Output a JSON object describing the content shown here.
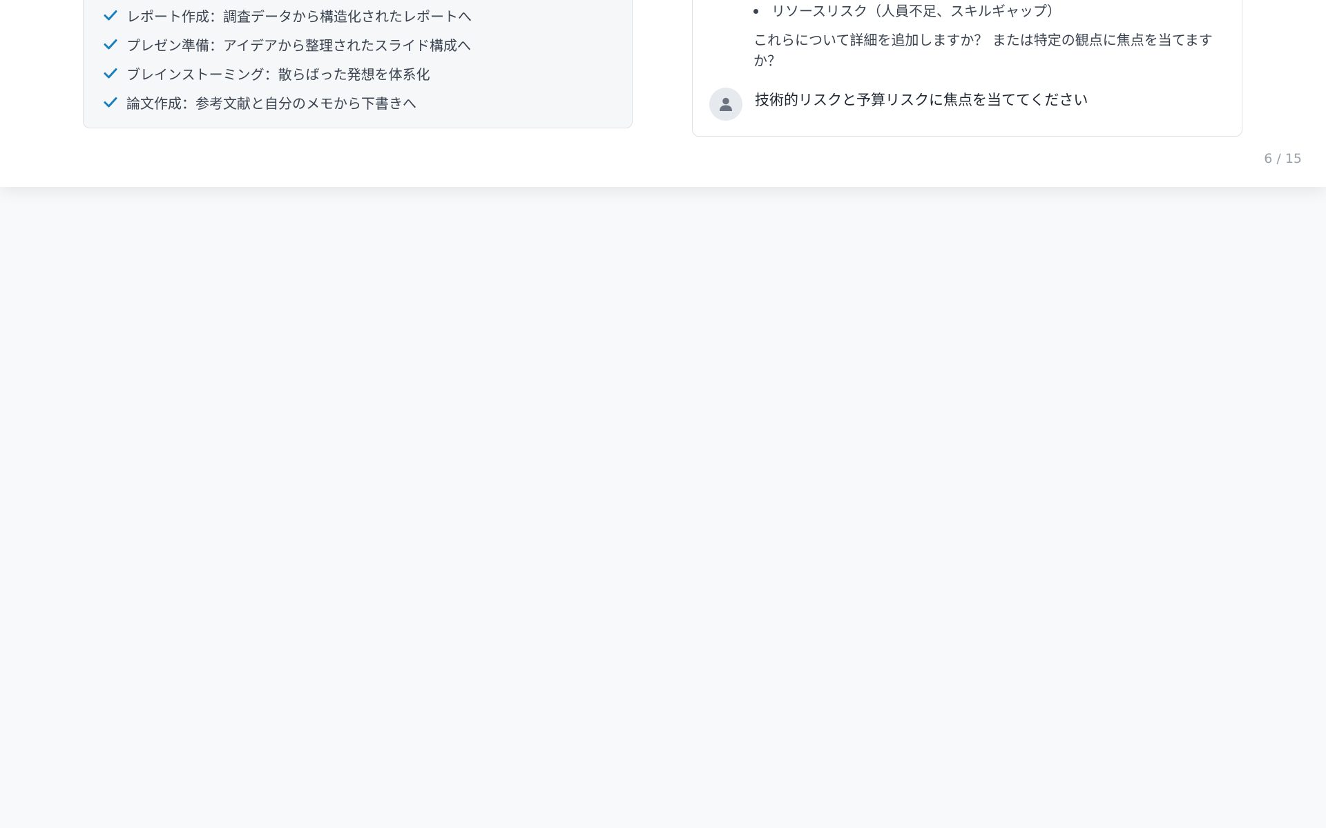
{
  "use_cases": [
    {
      "label": "レポート作成：調査データから構造化されたレポートへ",
      "icon": "check-icon"
    },
    {
      "label": "プレゼン準備：アイデアから整理されたスライド構成へ",
      "icon": "check-icon"
    },
    {
      "label": "ブレインストーミング：散らばった発想を体系化",
      "icon": "check-icon"
    },
    {
      "label": "論文作成：参考文献と自分のメモから下書きへ",
      "icon": "check-icon"
    }
  ],
  "chat": {
    "ai_bullets": [
      "リソースリスク（人員不足、スキルギャップ）"
    ],
    "ai_question": "これらについて詳細を追加しますか？ または特定の観点に焦点を当てますか？",
    "user_message": "技術的リスクと予算リスクに焦点を当ててください",
    "user_avatar_icon": "user-icon"
  },
  "pagination": {
    "counter": "6 / 15"
  },
  "colors": {
    "accent": "#1a7fbf",
    "text": "#3a4350",
    "muted": "#9aa1aa"
  }
}
